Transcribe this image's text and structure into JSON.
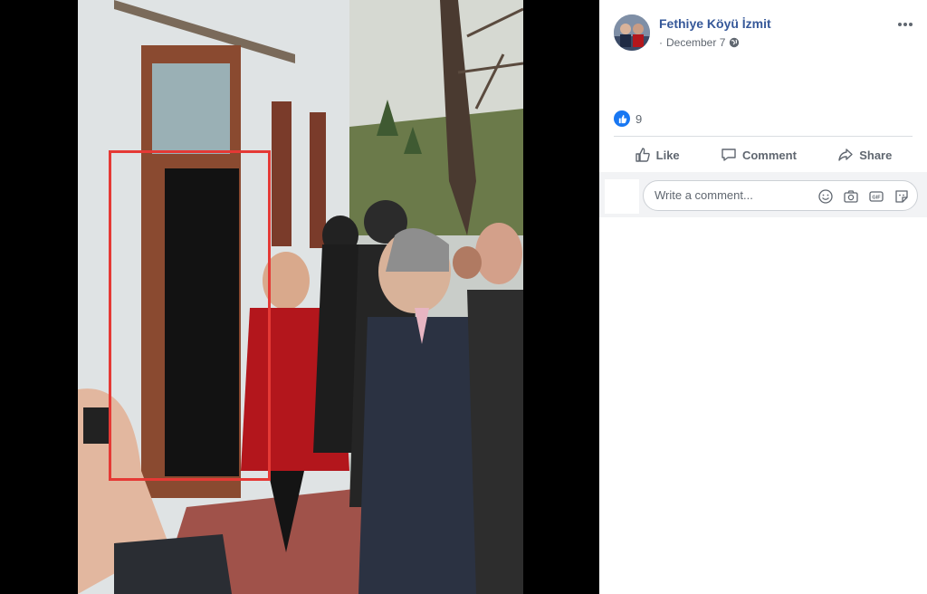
{
  "post": {
    "author": "Fethiye Köyü İzmit",
    "date": "December 7",
    "separator": "·",
    "privacy_icon": "globe-icon",
    "options_icon": "more-icon"
  },
  "reactions": {
    "type": "like",
    "count": "9"
  },
  "actions": {
    "like": "Like",
    "comment": "Comment",
    "share": "Share"
  },
  "comment_box": {
    "placeholder": "Write a comment...",
    "tools": [
      "emoji-icon",
      "camera-icon",
      "gif-icon",
      "sticker-icon"
    ]
  },
  "colors": {
    "author_link": "#365899",
    "like_blue": "#1877f2",
    "highlight_red": "#e53935"
  }
}
